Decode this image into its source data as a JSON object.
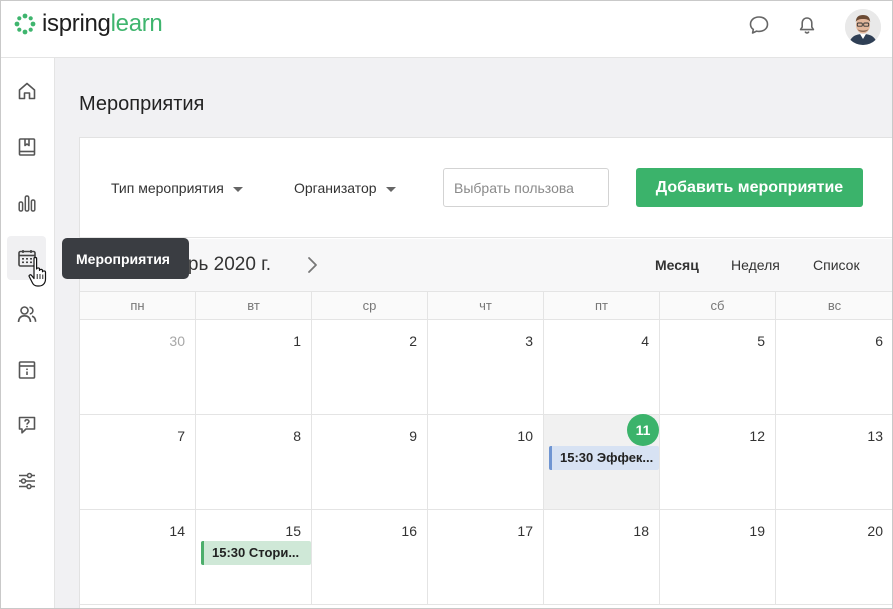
{
  "logo": {
    "part1": "ispring",
    "part2": "learn"
  },
  "topbar": {
    "icons": [
      "chat-icon",
      "bell-icon"
    ]
  },
  "sidebar": {
    "items": [
      {
        "name": "home-icon"
      },
      {
        "name": "book-icon"
      },
      {
        "name": "bar-chart-icon"
      },
      {
        "name": "calendar-icon",
        "active": true
      },
      {
        "name": "users-icon"
      },
      {
        "name": "info-book-icon"
      },
      {
        "name": "help-icon"
      },
      {
        "name": "settings-sliders-icon"
      }
    ]
  },
  "tooltip": {
    "text": "Мероприятия"
  },
  "page": {
    "title": "Мероприятия"
  },
  "filters": {
    "event_type": "Тип мероприятия",
    "organizer": "Организатор",
    "user_placeholder": "Выбрать пользова",
    "add_button": "Добавить мероприятие"
  },
  "calendar": {
    "month_label": "брь 2020 г.",
    "views": [
      "Месяц",
      "Неделя",
      "Список"
    ],
    "active_view": "Месяц",
    "weekdays": [
      "пн",
      "вт",
      "ср",
      "чт",
      "пт",
      "сб",
      "вс"
    ],
    "weeks": [
      [
        {
          "day": "30",
          "muted": true
        },
        {
          "day": "1"
        },
        {
          "day": "2"
        },
        {
          "day": "3"
        },
        {
          "day": "4"
        },
        {
          "day": "5"
        },
        {
          "day": "6"
        }
      ],
      [
        {
          "day": "7"
        },
        {
          "day": "8"
        },
        {
          "day": "9"
        },
        {
          "day": "10"
        },
        {
          "day": "11",
          "today": true,
          "event": {
            "text": "15:30 Эффек...",
            "color": "blue"
          }
        },
        {
          "day": "12"
        },
        {
          "day": "13"
        }
      ],
      [
        {
          "day": "14"
        },
        {
          "day": "15",
          "event": {
            "text": "15:30 Стори...",
            "color": "green"
          }
        },
        {
          "day": "16"
        },
        {
          "day": "17"
        },
        {
          "day": "18"
        },
        {
          "day": "19"
        },
        {
          "day": "20"
        }
      ]
    ]
  },
  "colors": {
    "accent": "#3bb36b",
    "event_blue": "#d7e2f3",
    "event_green": "#cfe8d7",
    "tooltip": "#3a3d42"
  }
}
